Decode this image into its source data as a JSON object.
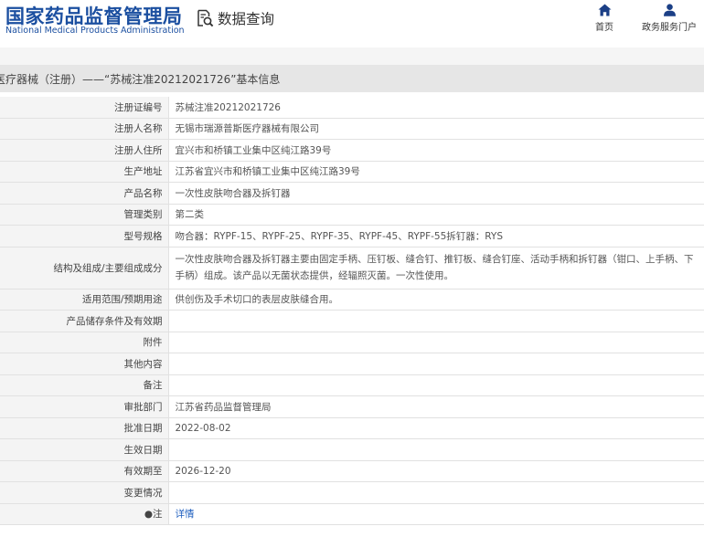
{
  "header": {
    "logo_cn": "国家药品监督管理局",
    "logo_en": "National Medical Products Administration",
    "query_label": "数据查询",
    "query_icon": "search-document-icon",
    "nav": [
      {
        "label": "首页",
        "icon": "home-icon"
      },
      {
        "label": "政务服务门户",
        "icon": "user-icon"
      }
    ]
  },
  "title": "医疗器械（注册）——“苏械注准20212021726”基本信息",
  "rows": [
    {
      "label": "注册证编号",
      "value": "苏械注准20212021726"
    },
    {
      "label": "注册人名称",
      "value": "无锡市瑞源普斯医疗器械有限公司"
    },
    {
      "label": "注册人住所",
      "value": "宜兴市和桥镇工业集中区纯江路39号"
    },
    {
      "label": "生产地址",
      "value": "江苏省宜兴市和桥镇工业集中区纯江路39号"
    },
    {
      "label": "产品名称",
      "value": "一次性皮肤吻合器及拆钉器"
    },
    {
      "label": "管理类别",
      "value": "第二类"
    },
    {
      "label": "型号规格",
      "value": "吻合器：RYPF-15、RYPF-25、RYPF-35、RYPF-45、RYPF-55拆钉器：RYS"
    },
    {
      "label": "结构及组成/主要组成成分",
      "value": "一次性皮肤吻合器及拆钉器主要由固定手柄、压钉板、缝合钉、推钉板、缝合钉座、活动手柄和拆钉器（钳口、上手柄、下手柄）组成。该产品以无菌状态提供，经辐照灭菌。一次性使用。"
    },
    {
      "label": "适用范围/预期用途",
      "value": "供创伤及手术切口的表层皮肤缝合用。"
    },
    {
      "label": "产品储存条件及有效期",
      "value": ""
    },
    {
      "label": "附件",
      "value": ""
    },
    {
      "label": "其他内容",
      "value": ""
    },
    {
      "label": "备注",
      "value": ""
    },
    {
      "label": "审批部门",
      "value": "江苏省药品监督管理局"
    },
    {
      "label": "批准日期",
      "value": "2022-08-02"
    },
    {
      "label": "生效日期",
      "value": ""
    },
    {
      "label": "有效期至",
      "value": "2026-12-20"
    },
    {
      "label": "变更情况",
      "value": ""
    },
    {
      "label": "●注",
      "value": "详情"
    }
  ],
  "colors": {
    "brand": "#1b4fa0",
    "link": "#1f5fbf",
    "title_bg": "#e6e6e6",
    "label_bg": "#f4f4f4"
  }
}
